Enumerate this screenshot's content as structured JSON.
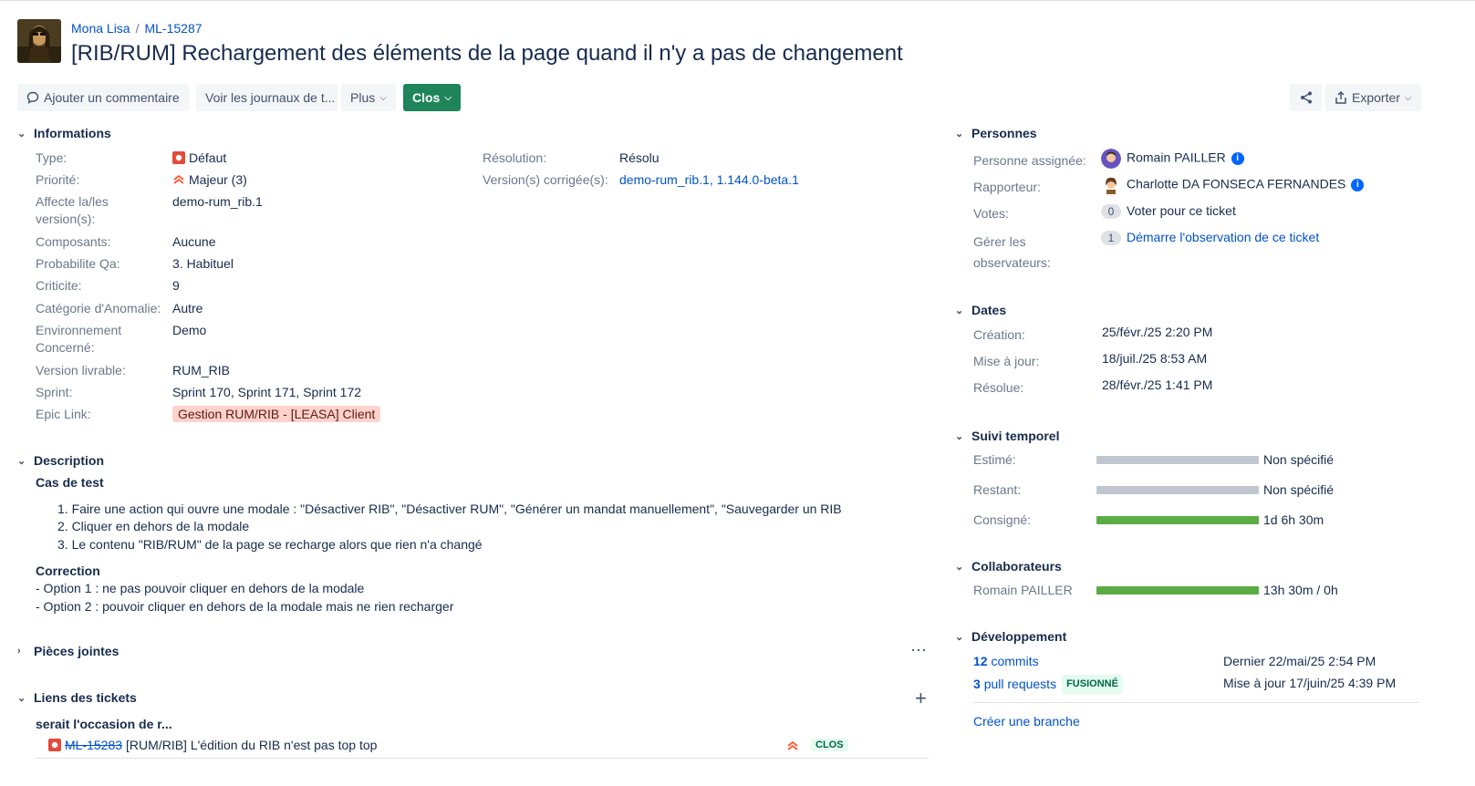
{
  "breadcrumb": {
    "project": "Mona Lisa",
    "separator": "/",
    "issue_key": "ML-15287"
  },
  "issue": {
    "title": "[RIB/RUM] Rechargement des éléments de la page quand il n'y a pas de changement"
  },
  "toolbar": {
    "comment": "Ajouter un commentaire",
    "logs": "Voir les journaux de t...",
    "more": "Plus",
    "status": "Clos",
    "export": "Exporter"
  },
  "sections": {
    "informations": "Informations",
    "description": "Description",
    "attachments": "Pièces jointes",
    "links": "Liens des tickets",
    "people": "Personnes",
    "dates": "Dates",
    "time_tracking": "Suivi temporel",
    "collaborators": "Collaborateurs",
    "development": "Développement"
  },
  "details": [
    {
      "label": "Type:",
      "value": "Défaut"
    },
    {
      "label": "Priorité:",
      "value": "Majeur (3)"
    },
    {
      "label": "Affecte la/les version(s):",
      "value": "demo-rum_rib.1"
    },
    {
      "label": "Composants:",
      "value": "Aucune"
    },
    {
      "label": "Probabilite Qa:",
      "value": "3. Habituel"
    },
    {
      "label": "Criticite:",
      "value": "9"
    },
    {
      "label": "Catégorie d'Anomalie:",
      "value": "Autre"
    },
    {
      "label": "Environnement Concerné:",
      "value": "Demo"
    },
    {
      "label": "Version livrable:",
      "value": "RUM_RIB"
    },
    {
      "label": "Sprint:",
      "value": "Sprint 170, Sprint 171, Sprint 172"
    },
    {
      "label": "Epic Link:",
      "value": "Gestion RUM/RIB - [LEASA] Client"
    }
  ],
  "resolution": {
    "label": "Résolution:",
    "value": "Résolu"
  },
  "fix_versions": {
    "label": "Version(s) corrigée(s):",
    "value": "demo-rum_rib.1, 1.144.0-beta.1"
  },
  "description": {
    "heading1": "Cas de test",
    "steps": [
      "1. Faire une action qui ouvre une modale : \"Désactiver RIB\", \"Désactiver RUM\", \"Générer un mandat manuellement\", \"Sauvegarder un RIB",
      "2. Cliquer en dehors de la modale",
      "3. Le contenu \"RIB/RUM\" de la page se recharge alors que rien n'a changé"
    ],
    "heading2": "Correction",
    "options": [
      "- Option 1 : ne pas pouvoir cliquer en dehors de la modale",
      "- Option 2 : pouvoir cliquer en dehors de la modale mais ne rien recharger"
    ]
  },
  "links": {
    "group": "serait l'occasion de r...",
    "item_key": "ML-15283",
    "item_title": "[RUM/RIB] L'édition du RIB n'est pas top top",
    "item_status": "CLOS"
  },
  "people": {
    "assignee_label": "Personne assignée:",
    "assignee": "Romain PAILLER",
    "reporter_label": "Rapporteur:",
    "reporter": "Charlotte DA FONSECA FERNANDES",
    "votes_label": "Votes:",
    "votes_count": "0",
    "votes_action": "Voter pour ce ticket",
    "watchers_label": "Gérer les observateurs:",
    "watchers_count": "1",
    "watchers_action": "Démarre l'observation de ce ticket"
  },
  "dates": {
    "created_label": "Création:",
    "created": "25/févr./25 2:20 PM",
    "updated_label": "Mise à jour:",
    "updated": "18/juil./25 8:53 AM",
    "resolved_label": "Résolue:",
    "resolved": "28/févr./25 1:41 PM"
  },
  "time_tracking": {
    "estimated_label": "Estimé:",
    "estimated": "Non spécifié",
    "remaining_label": "Restant:",
    "remaining": "Non spécifié",
    "logged_label": "Consigné:",
    "logged": "1d 6h 30m"
  },
  "collaborators": {
    "name": "Romain PAILLER",
    "time": "13h 30m / 0h"
  },
  "development": {
    "commits_count": "12",
    "commits_label": "commits",
    "commits_date": "Dernier 22/mai/25 2:54 PM",
    "pr_count": "3",
    "pr_label": "pull requests",
    "pr_status": "FUSIONNÉ",
    "pr_date": "Mise à jour 17/juin/25 4:39 PM",
    "create_branch": "Créer une branche"
  },
  "colors": {
    "status_green": "#1f845a",
    "link": "#0052cc",
    "bug_red": "#e5493a",
    "bar_green": "#5aac44"
  }
}
